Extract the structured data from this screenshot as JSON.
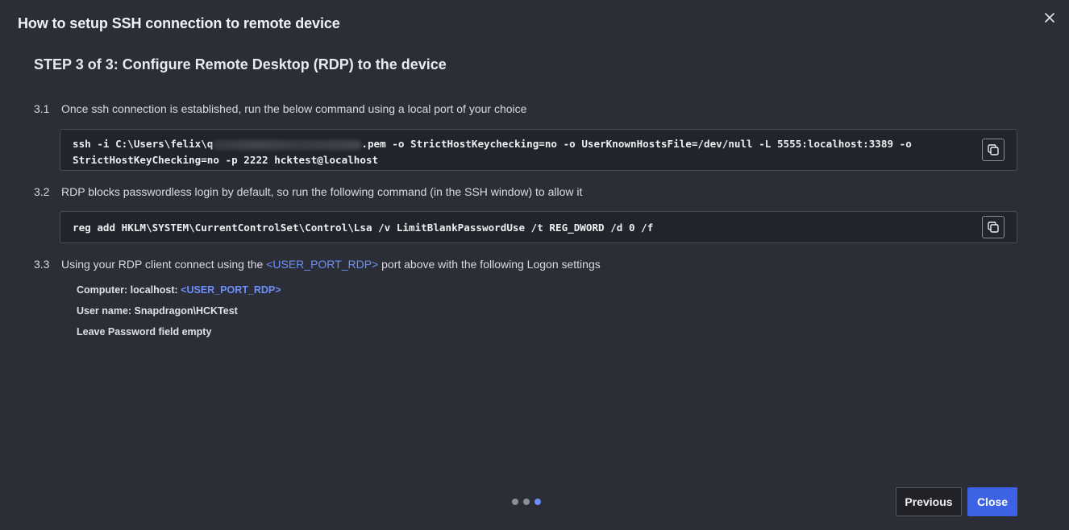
{
  "modal": {
    "title": "How to setup SSH connection to remote device",
    "step_title": "STEP 3 of 3: Configure Remote Desktop (RDP) to the device"
  },
  "steps": {
    "s1": {
      "num": "3.1",
      "text": "Once ssh connection is established, run the below command using a local port of your choice",
      "code_line1_prefix": "ssh -i C:\\Users\\felix\\q",
      "code_line1_suffix": ".pem -o StrictHostKeychecking=no -o UserKnownHostsFile=/dev/null -L 5555:localhost:3389 -o",
      "code_line2": "StrictHostKeyChecking=no -p 2222 hcktest@localhost"
    },
    "s2": {
      "num": "3.2",
      "text": "RDP blocks passwordless login by default, so run the following command (in the SSH window) to allow it",
      "code": "reg add HKLM\\SYSTEM\\CurrentControlSet\\Control\\Lsa /v LimitBlankPasswordUse /t REG_DWORD /d 0 /f"
    },
    "s3": {
      "num": "3.3",
      "text_before": "Using your RDP client connect using the ",
      "link": "<USER_PORT_RDP>",
      "text_after": " port above with the following Logon settings",
      "computer_label": "Computer: localhost: ",
      "computer_value": "<USER_PORT_RDP>",
      "username": "User name: Snapdragon\\HCKTest",
      "password_note": "Leave Password field empty"
    }
  },
  "pagination": {
    "total": 3,
    "current": 3
  },
  "buttons": {
    "previous": "Previous",
    "close": "Close"
  },
  "colors": {
    "background": "#2c2e37",
    "code_bg": "#22242b",
    "accent": "#3d62e3",
    "link": "#6d8ff7"
  },
  "icons": {
    "close": "close-icon",
    "copy": "copy-icon"
  }
}
